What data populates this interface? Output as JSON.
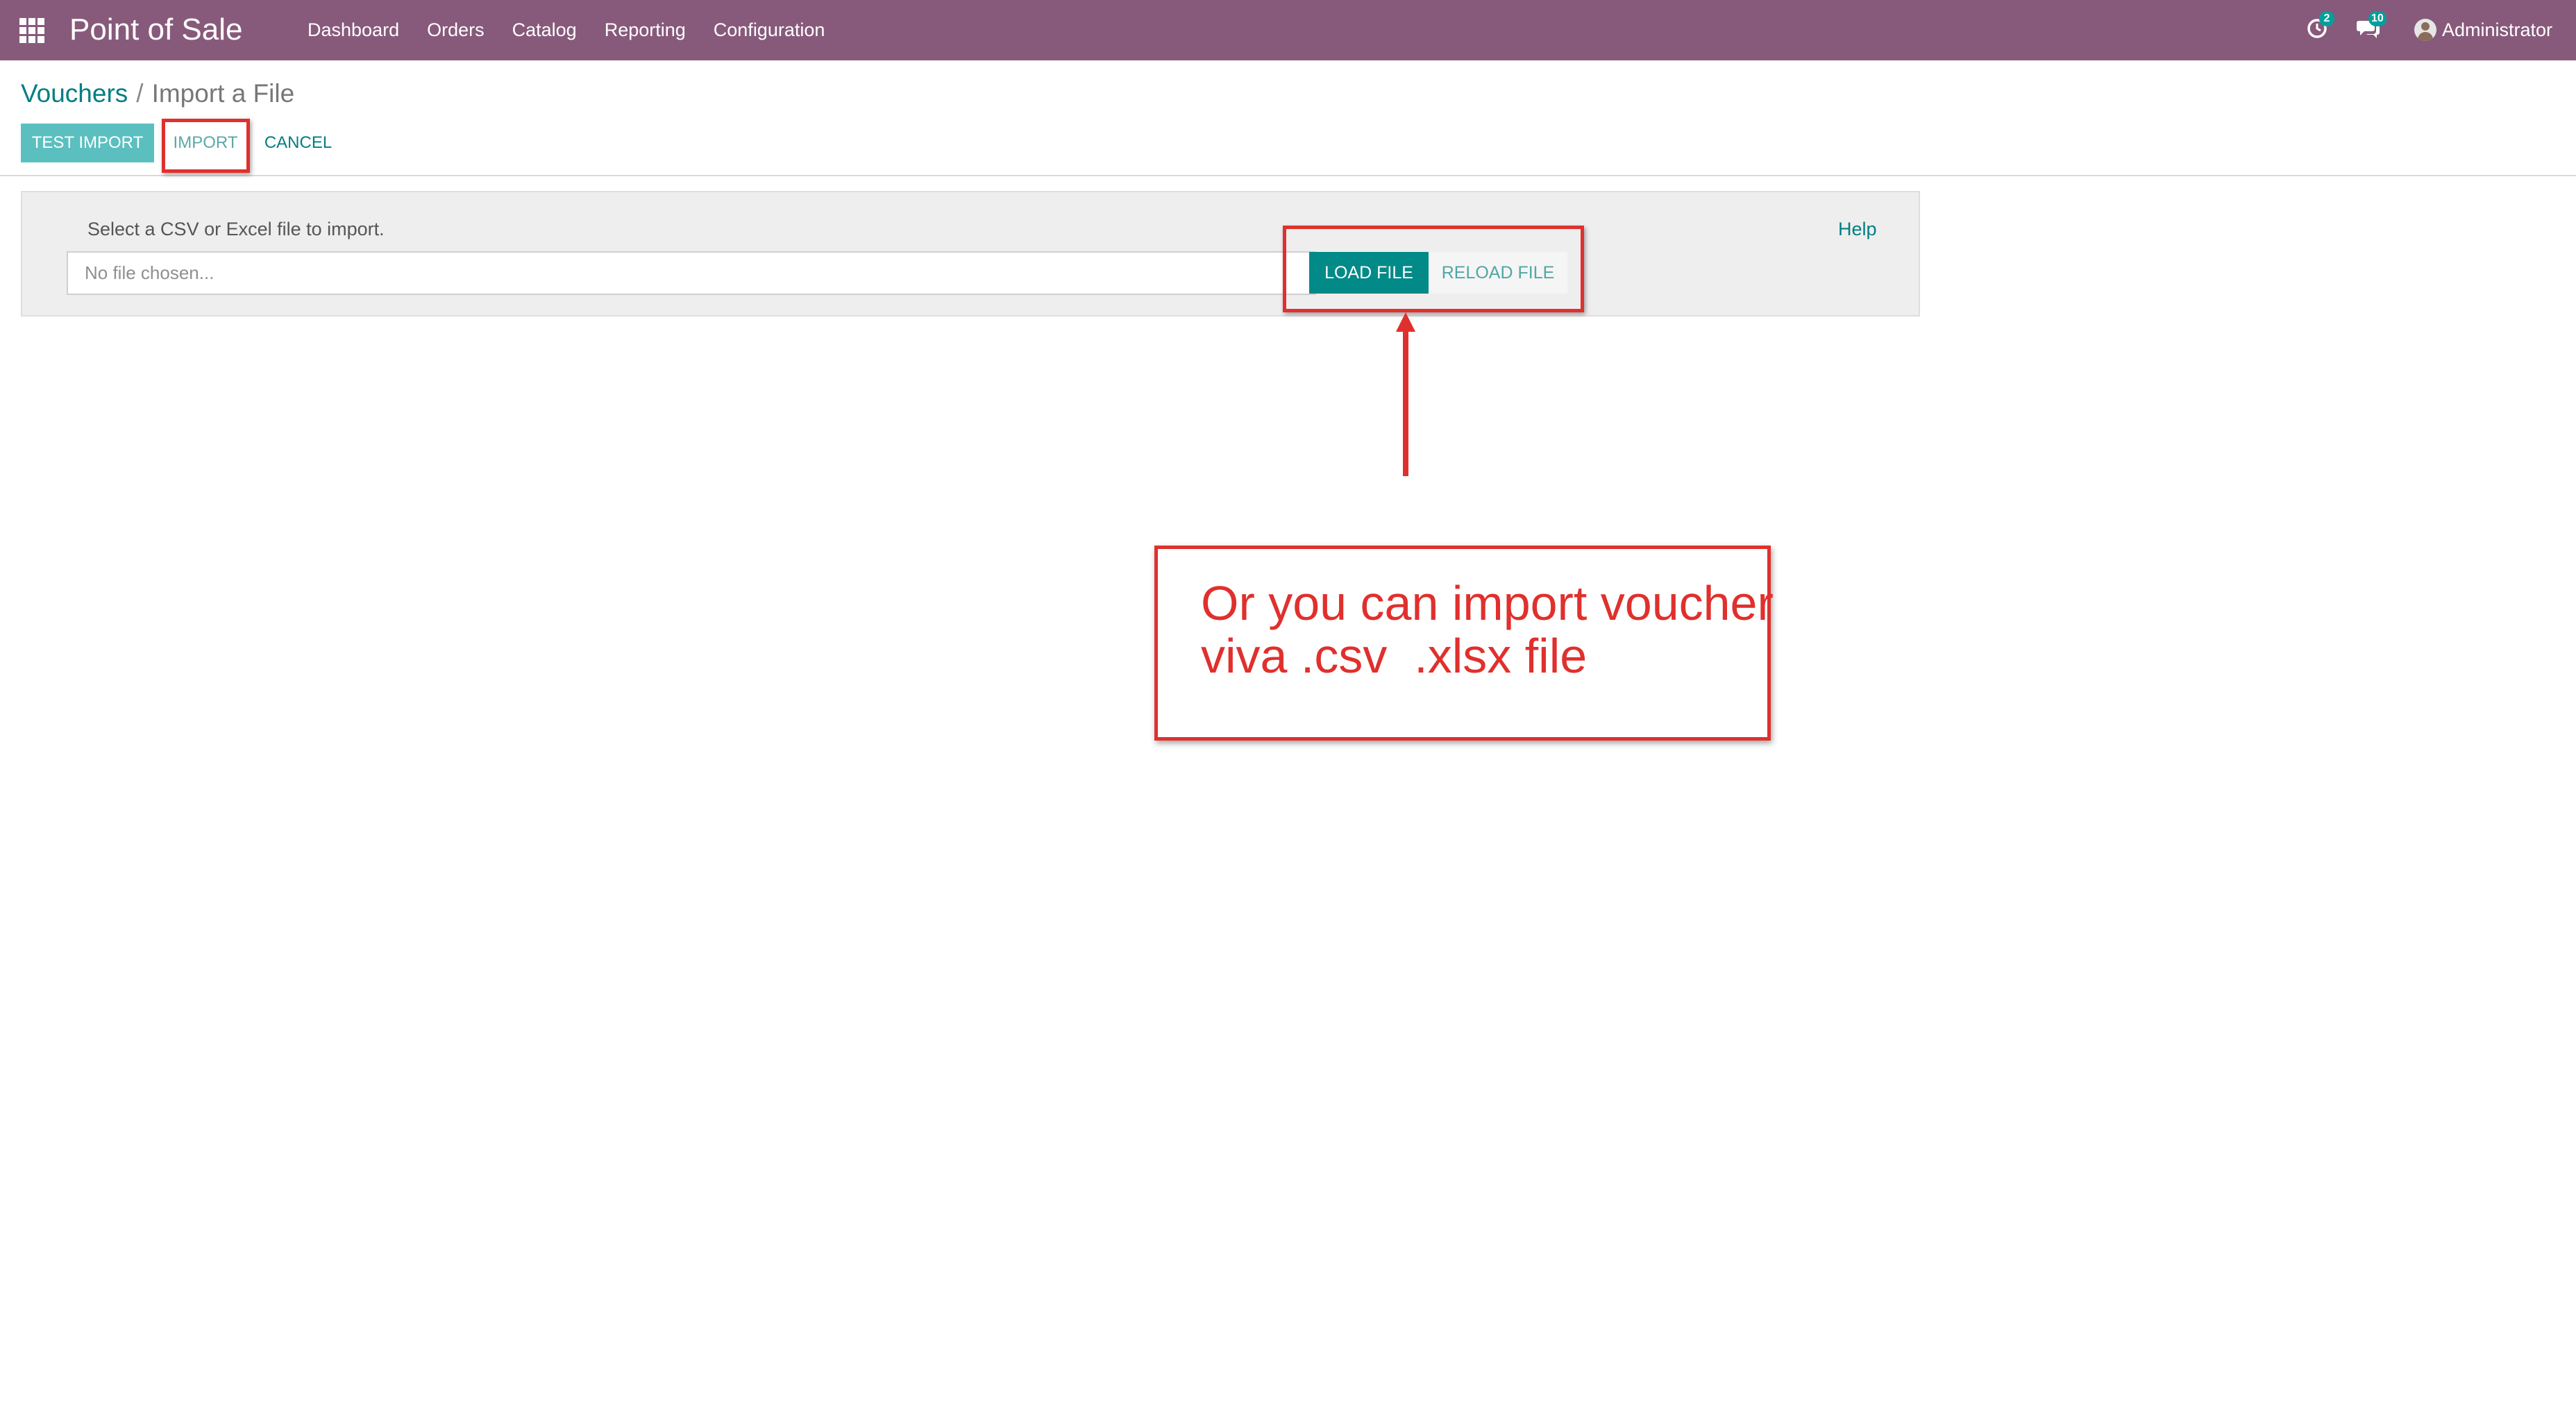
{
  "navbar": {
    "app_title": "Point of Sale",
    "menu": [
      "Dashboard",
      "Orders",
      "Catalog",
      "Reporting",
      "Configuration"
    ],
    "activity_badge": "2",
    "messages_badge": "10",
    "user_name": "Administrator",
    "background_color": "#875a7b"
  },
  "breadcrumb": {
    "parent": "Vouchers",
    "separator": "/",
    "current": "Import a File"
  },
  "toolbar": {
    "test_import_label": "TEST IMPORT",
    "import_label": "IMPORT",
    "cancel_label": "CANCEL"
  },
  "import_panel": {
    "instruction": "Select a CSV or Excel file to import.",
    "file_placeholder": "No file chosen...",
    "load_file_label": "LOAD FILE",
    "reload_file_label": "RELOAD FILE",
    "help_label": "Help"
  },
  "annotation": {
    "line1": "Or you can import voucher",
    "line2": "viva .csv  .xlsx file",
    "color": "#e0302d"
  },
  "icons": [
    "apps-grid-icon",
    "activity-clock-icon",
    "chat-bubbles-icon",
    "user-avatar-icon",
    "arrow-up-icon"
  ]
}
